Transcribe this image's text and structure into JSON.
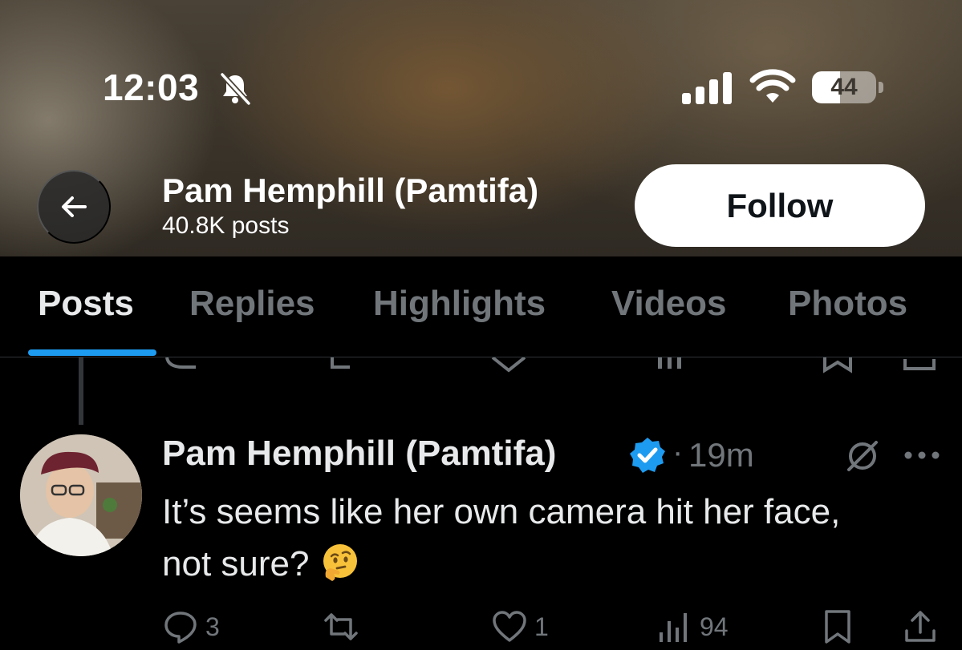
{
  "status_bar": {
    "time": "12:03",
    "battery_level": "44",
    "battery_fraction": 0.44
  },
  "header": {
    "name": "Pam Hemphill (Pamtifa)",
    "posts_count": "40.8K posts",
    "follow_label": "Follow"
  },
  "tabs": [
    {
      "label": "Posts",
      "active": true
    },
    {
      "label": "Replies",
      "active": false
    },
    {
      "label": "Highlights",
      "active": false
    },
    {
      "label": "Videos",
      "active": false
    },
    {
      "label": "Photos",
      "active": false
    }
  ],
  "post": {
    "author": "Pam Hemphill (Pamtifa)",
    "time": "19m",
    "separator": "·",
    "text": "It’s seems like her own camera hit her face, not sure?",
    "emoji": "thinking-face-icon",
    "actions": {
      "replies": "3",
      "reposts": "",
      "likes": "1",
      "views": "94"
    }
  },
  "colors": {
    "accent": "#1d9bf0",
    "muted_text": "#71767b",
    "text": "#e7e9ea",
    "background": "#000000"
  }
}
